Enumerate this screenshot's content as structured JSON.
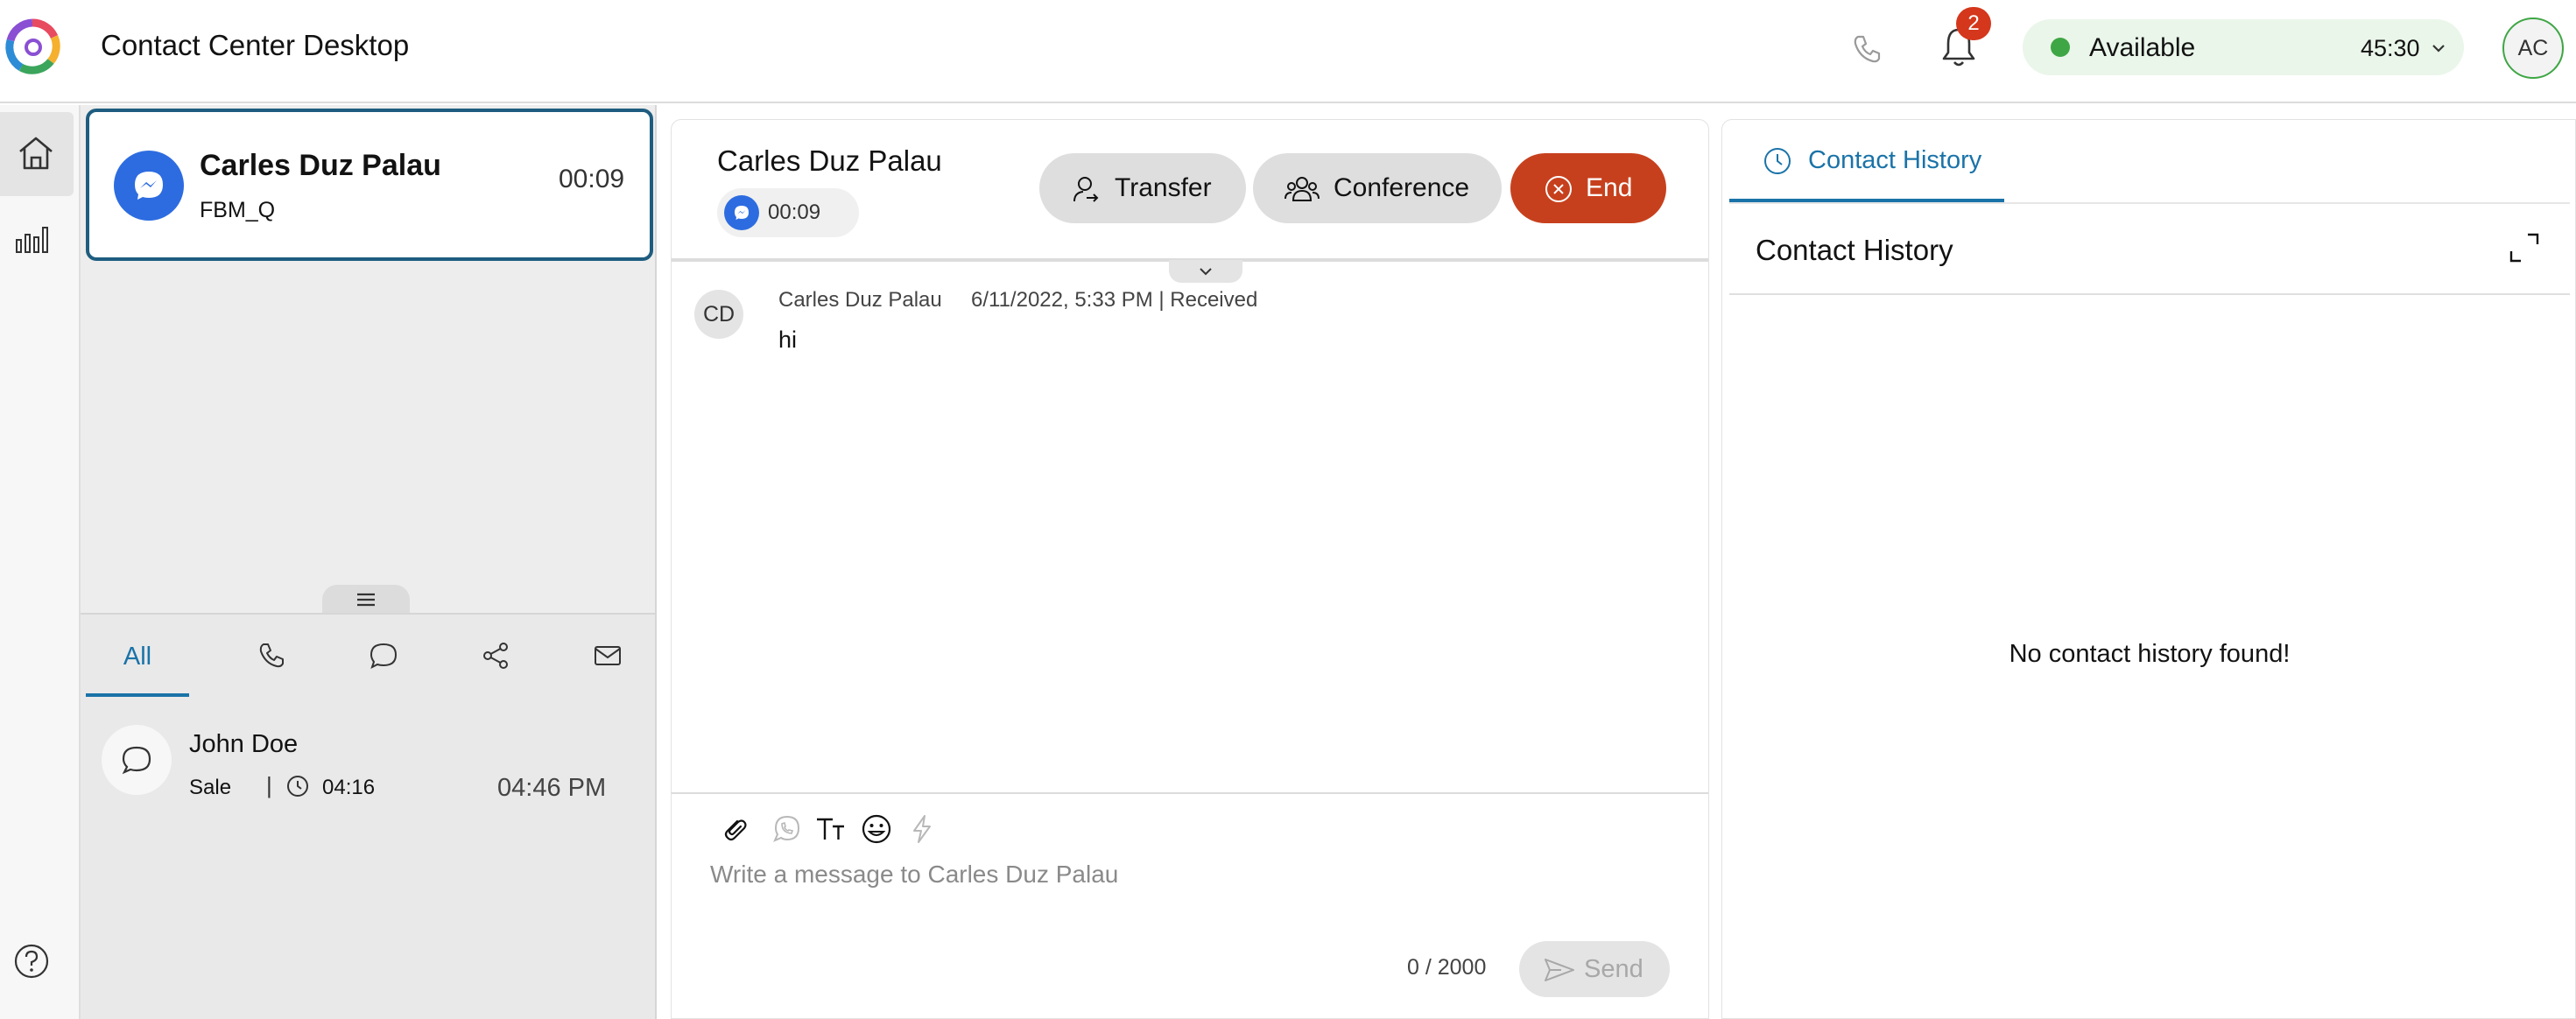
{
  "header": {
    "app_title": "Contact Center Desktop",
    "notification_count": "2",
    "agent_state": "Available",
    "state_timer": "45:30",
    "user_initials": "AC"
  },
  "active_task": {
    "customer_name": "Carles Duz Palau",
    "queue": "FBM_Q",
    "timer": "00:09",
    "channel_icon": "messenger-icon"
  },
  "filter_tabs": [
    {
      "label": "All",
      "selected": true
    },
    {
      "icon": "phone-icon"
    },
    {
      "icon": "chat-icon"
    },
    {
      "icon": "share-icon"
    },
    {
      "icon": "email-icon"
    }
  ],
  "history_items": [
    {
      "name": "John Doe",
      "type": "Sale",
      "separator": "|",
      "duration": "04:16",
      "time": "04:46 PM",
      "icon": "chat-icon"
    }
  ],
  "chat": {
    "customer_name": "Carles Duz Palau",
    "timer": "00:09",
    "buttons": {
      "transfer": "Transfer",
      "conference": "Conference",
      "end": "End"
    },
    "messages": [
      {
        "avatar": "CD",
        "sender": "Carles Duz Palau",
        "meta": "6/11/2022, 5:33 PM | Received",
        "text": "hi"
      }
    ],
    "composer": {
      "placeholder": "Write a message to Carles Duz Palau",
      "char_count": "0 / 2000",
      "send_label": "Send",
      "tools": [
        "attachment-icon",
        "whatsapp-icon",
        "text-format-icon",
        "emoji-icon",
        "quick-reply-icon"
      ]
    }
  },
  "contact_history": {
    "tab_label": "Contact History",
    "title": "Contact History",
    "empty_message": "No contact history found!"
  },
  "colors": {
    "accent": "#1a73a8",
    "end_button": "#c7401d",
    "available": "#3fa645",
    "badge": "#d4371c",
    "messenger": "#2d6ce0"
  }
}
